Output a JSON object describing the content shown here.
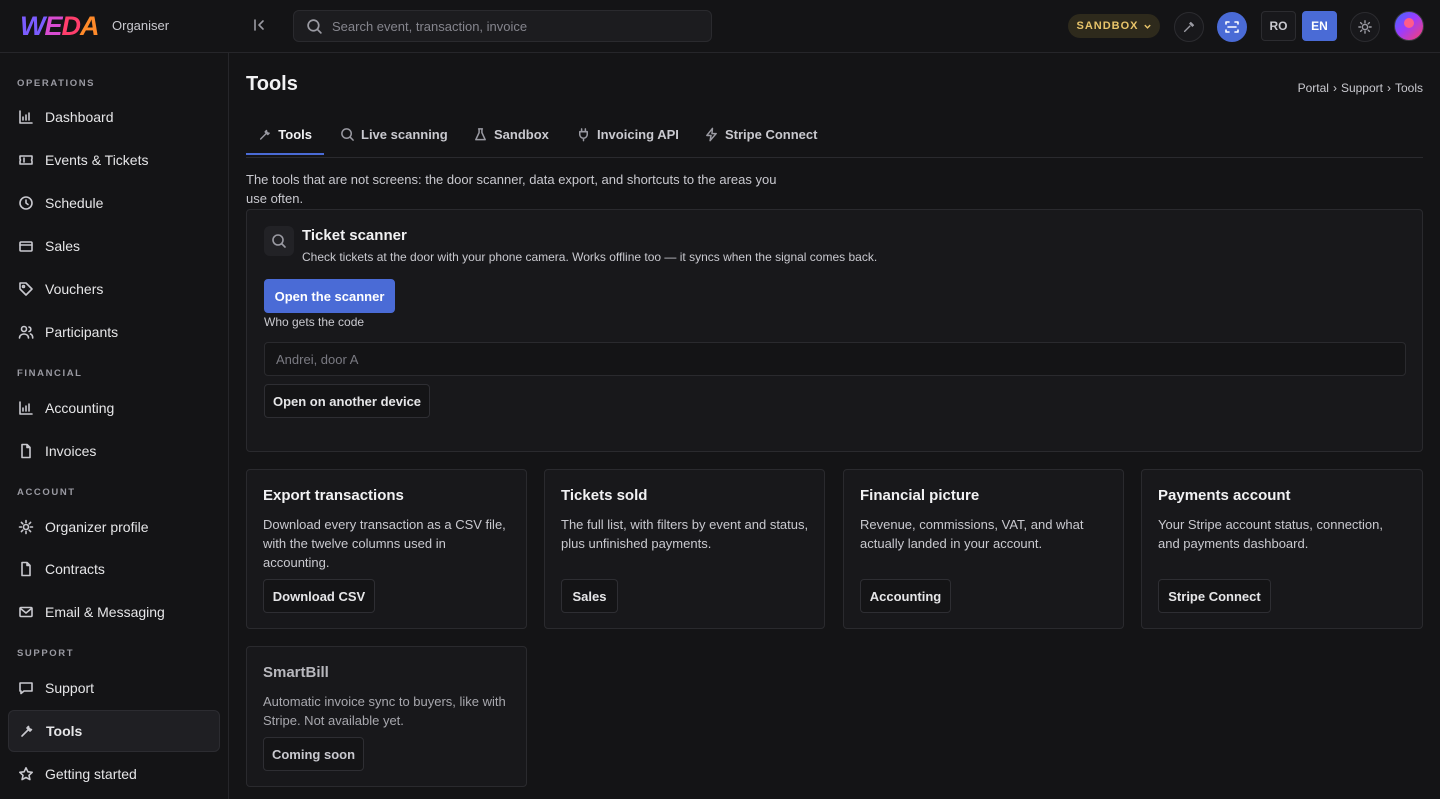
{
  "brand": {
    "logo_letters": [
      "W",
      "E",
      "D",
      "A"
    ],
    "org_label": "Organiser"
  },
  "search": {
    "placeholder": "Search event, transaction, invoice"
  },
  "topbar": {
    "sandbox_label": "SANDBOX",
    "lang_ro": "RO",
    "lang_en": "EN",
    "active_lang": "EN"
  },
  "sidebar": {
    "sections": [
      {
        "title": "OPERATIONS",
        "items": [
          {
            "label": "Dashboard",
            "icon": "chart-icon"
          },
          {
            "label": "Events & Tickets",
            "icon": "ticket-icon"
          },
          {
            "label": "Schedule",
            "icon": "clock-icon"
          },
          {
            "label": "Sales",
            "icon": "card-icon"
          },
          {
            "label": "Vouchers",
            "icon": "tag-icon"
          },
          {
            "label": "Participants",
            "icon": "users-icon"
          }
        ]
      },
      {
        "title": "FINANCIAL",
        "items": [
          {
            "label": "Accounting",
            "icon": "chart-icon"
          },
          {
            "label": "Invoices",
            "icon": "document-icon"
          }
        ]
      },
      {
        "title": "ACCOUNT",
        "items": [
          {
            "label": "Organizer profile",
            "icon": "sun-icon"
          },
          {
            "label": "Contracts",
            "icon": "document-icon"
          },
          {
            "label": "Email & Messaging",
            "icon": "mail-icon"
          }
        ]
      },
      {
        "title": "SUPPORT",
        "items": [
          {
            "label": "Support",
            "icon": "chat-icon"
          },
          {
            "label": "Tools",
            "icon": "tool-icon",
            "active": true
          },
          {
            "label": "Getting started",
            "icon": "star-icon"
          }
        ]
      }
    ]
  },
  "page": {
    "title": "Tools",
    "breadcrumb": [
      "Portal",
      "Support",
      "Tools"
    ],
    "breadcrumb_sep": "›",
    "intro": "The tools that are not screens: the door scanner, data export, and shortcuts to the areas you use often."
  },
  "tabs": [
    {
      "label": "Tools",
      "icon": "tool-icon",
      "active": true
    },
    {
      "label": "Live scanning",
      "icon": "search-icon"
    },
    {
      "label": "Sandbox",
      "icon": "flask-icon"
    },
    {
      "label": "Invoicing API",
      "icon": "plug-icon"
    },
    {
      "label": "Stripe Connect",
      "icon": "bolt-icon"
    }
  ],
  "scanner": {
    "title": "Ticket scanner",
    "description": "Check tickets at the door with your phone camera. Works offline too — it syncs when the signal comes back.",
    "open_button": "Open the scanner",
    "field_label": "Who gets the code",
    "field_placeholder": "Andrei, door A",
    "device_button": "Open on another device"
  },
  "cards": [
    {
      "title": "Export transactions",
      "description": "Download every transaction as a CSV file, with the twelve columns used in accounting.",
      "button": "Download CSV"
    },
    {
      "title": "Tickets sold",
      "description": "The full list, with filters by event and status, plus unfinished payments.",
      "button": "Sales"
    },
    {
      "title": "Financial picture",
      "description": "Revenue, commissions, VAT, and what actually landed in your account.",
      "button": "Accounting"
    },
    {
      "title": "Payments account",
      "description": "Your Stripe account status, connection, and payments dashboard.",
      "button": "Stripe Connect"
    },
    {
      "title": "SmartBill",
      "description": "Automatic invoice sync to buyers, like with Stripe. Not available yet.",
      "button": "Coming soon",
      "disabled": true
    }
  ],
  "colors": {
    "accent": "#4a6bd6",
    "sandbox": "#e8c46a",
    "background": "#141416"
  }
}
